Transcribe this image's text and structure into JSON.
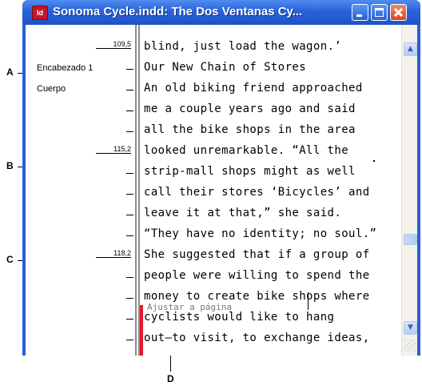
{
  "window": {
    "app_icon_text": "Id",
    "title": "Sonoma Cycle.indd: The Dos Ventanas Cy..."
  },
  "styles": [
    "Encabezado 1",
    "Cuerpo"
  ],
  "depths": [
    "109,5",
    "115,2",
    "118,2"
  ],
  "story_lines": [
    "blind, just load the wagon.’",
    "Our New Chain of Stores",
    "An old biking friend approached",
    "me a couple years ago and said",
    "all the bike shops in the area",
    "looked unremarkable. “All the",
    "strip-mall shops might as well",
    "call their stores ‘Bicycles’ and",
    "leave it at that,” she said.",
    "“They have no identity; no soul.”",
    "She suggested that if a group of",
    "people were willing to spend the",
    "money to create bike shops where",
    "cyclists would like to hang",
    "out—to visit, to exchange ideas,"
  ],
  "overset_label": "Ajustar a página",
  "callouts": [
    "A",
    "B",
    "C",
    "D"
  ]
}
